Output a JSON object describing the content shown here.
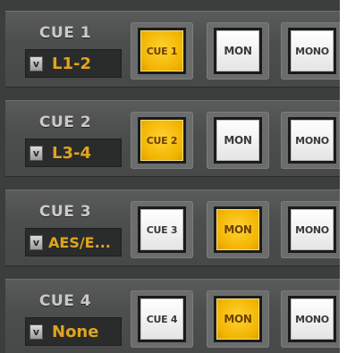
{
  "cues": [
    {
      "label": "CUE 1",
      "source": "L1-2",
      "buttons": [
        {
          "label": "CUE 1",
          "active": true
        },
        {
          "label": "MON",
          "active": false
        },
        {
          "label": "MONO",
          "active": false
        }
      ]
    },
    {
      "label": "CUE 2",
      "source": "L3-4",
      "buttons": [
        {
          "label": "CUE 2",
          "active": true
        },
        {
          "label": "MON",
          "active": false
        },
        {
          "label": "MONO",
          "active": false
        }
      ]
    },
    {
      "label": "CUE 3",
      "source": "AES/E...",
      "buttons": [
        {
          "label": "CUE 3",
          "active": false
        },
        {
          "label": "MON",
          "active": true
        },
        {
          "label": "MONO",
          "active": false
        }
      ]
    },
    {
      "label": "CUE 4",
      "source": "None",
      "buttons": [
        {
          "label": "CUE 4",
          "active": false
        },
        {
          "label": "MON",
          "active": true
        },
        {
          "label": "MONO",
          "active": false
        }
      ]
    }
  ],
  "icons": {
    "dropdown": "chevron-down-icon"
  },
  "colors": {
    "active_button": "#f2b400",
    "source_text": "#e0a51e",
    "panel_bg": "#3c3d3d"
  }
}
